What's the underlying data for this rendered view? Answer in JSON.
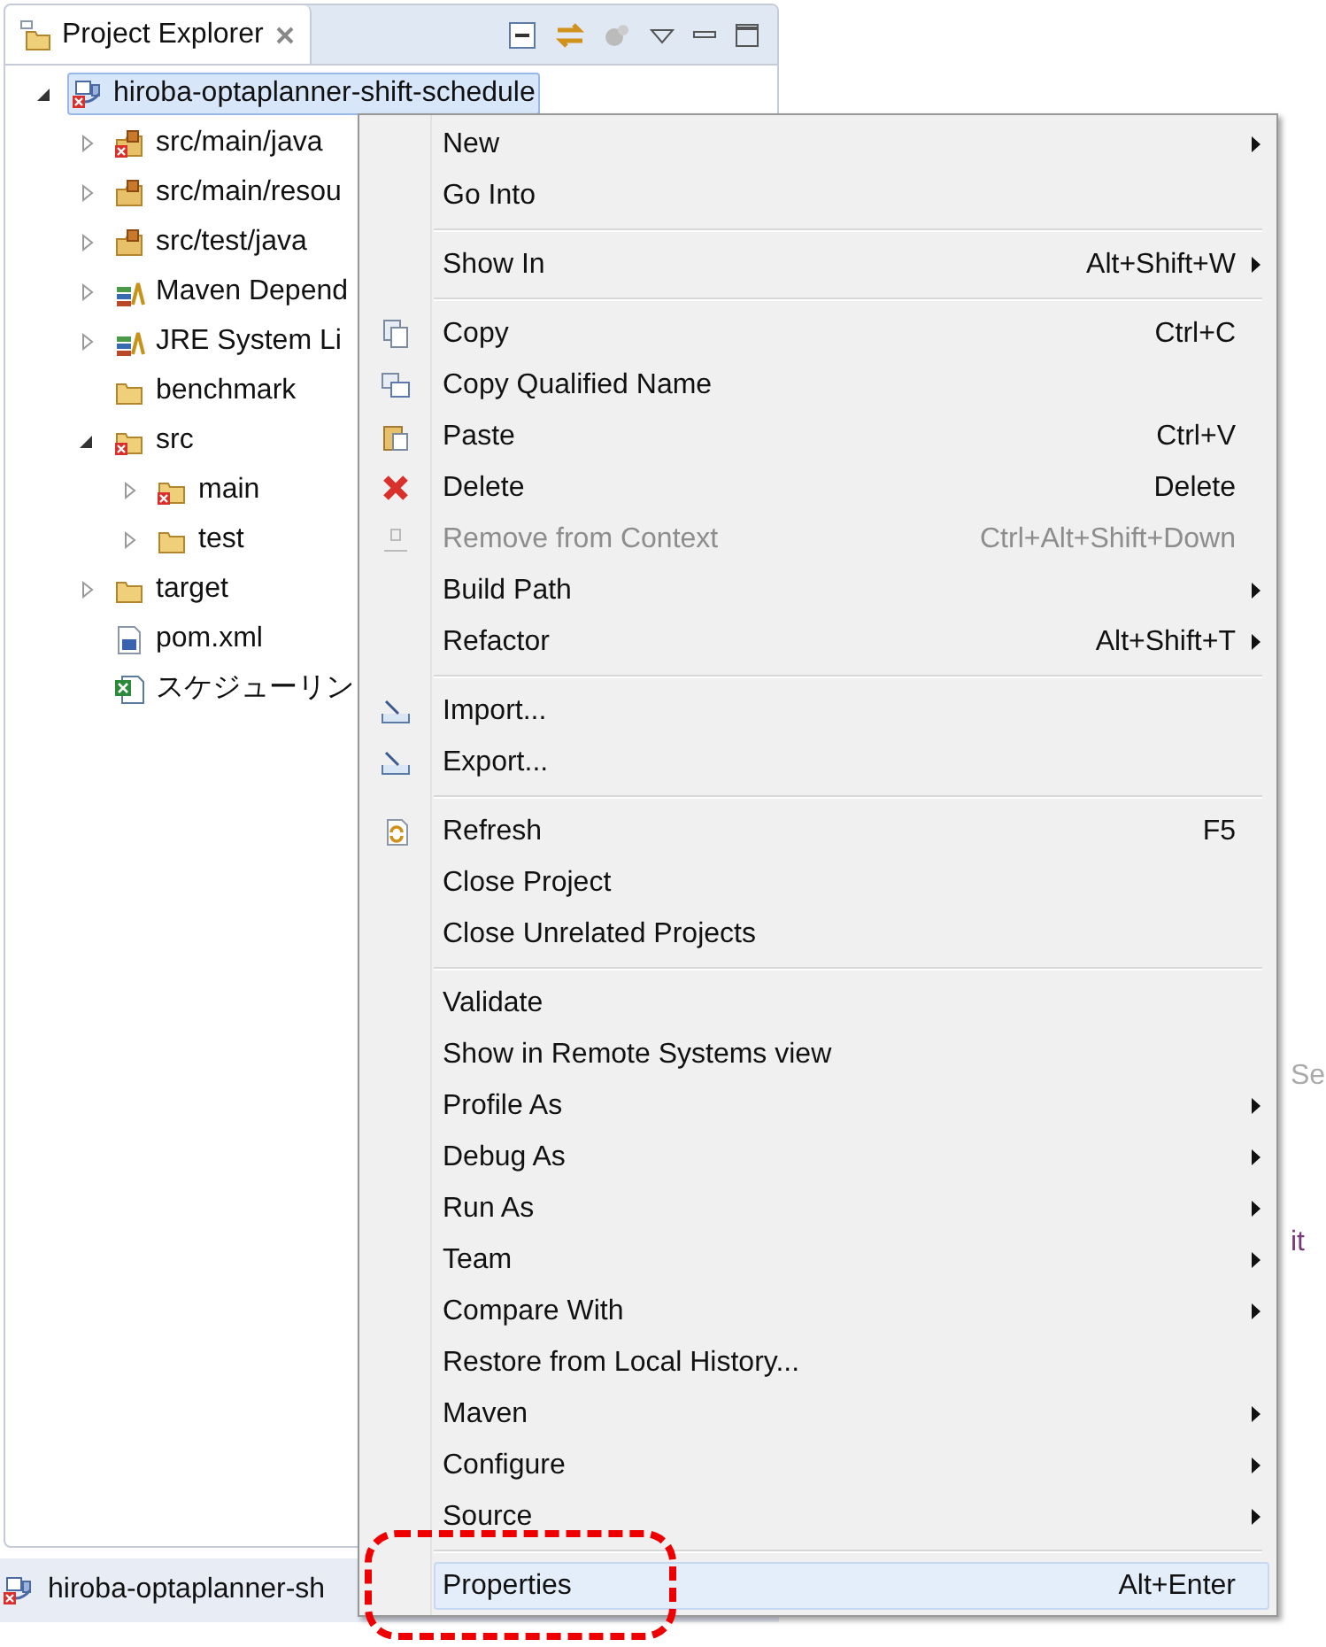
{
  "panel": {
    "title": "Project Explorer",
    "tree": [
      {
        "label": "hiroba-optaplanner-shift-schedule",
        "kind": "project",
        "error": true,
        "selected": true,
        "expanded": true,
        "children": [
          {
            "label": "src/main/java",
            "kind": "package-folder",
            "error": true,
            "selected": false,
            "expanded": false
          },
          {
            "label": "src/main/resou",
            "kind": "package-folder",
            "error": false,
            "selected": false,
            "expanded": false
          },
          {
            "label": "src/test/java",
            "kind": "package-folder",
            "error": false,
            "selected": false,
            "expanded": false
          },
          {
            "label": "Maven Depend",
            "kind": "library",
            "error": false,
            "selected": false,
            "expanded": false
          },
          {
            "label": "JRE System Li",
            "kind": "library",
            "error": false,
            "selected": false,
            "expanded": false
          },
          {
            "label": "benchmark",
            "kind": "folder",
            "error": false,
            "selected": false
          },
          {
            "label": "src",
            "kind": "folder",
            "error": true,
            "selected": false,
            "expanded": true,
            "children": [
              {
                "label": "main",
                "kind": "folder",
                "error": true,
                "selected": false,
                "expanded": false
              },
              {
                "label": "test",
                "kind": "folder",
                "error": false,
                "selected": false,
                "expanded": false
              }
            ]
          },
          {
            "label": "target",
            "kind": "folder",
            "error": false,
            "selected": false,
            "expanded": false
          },
          {
            "label": "pom.xml",
            "kind": "maven-file",
            "error": false,
            "selected": false
          },
          {
            "label": "スケジューリン",
            "kind": "excel-file",
            "error": false,
            "selected": false
          }
        ]
      }
    ]
  },
  "context_menu": {
    "groups": [
      [
        {
          "label": "New",
          "submenu": true,
          "disabled": false,
          "selected": false
        },
        {
          "label": "Go Into",
          "submenu": false,
          "disabled": false,
          "selected": false
        }
      ],
      [
        {
          "label": "Show In",
          "shortcut": "Alt+Shift+W",
          "submenu": true,
          "disabled": false,
          "selected": false
        }
      ],
      [
        {
          "label": "Copy",
          "shortcut": "Ctrl+C",
          "submenu": false,
          "disabled": false,
          "selected": false
        },
        {
          "label": "Copy Qualified Name",
          "submenu": false,
          "disabled": false,
          "selected": false
        },
        {
          "label": "Paste",
          "shortcut": "Ctrl+V",
          "submenu": false,
          "disabled": false,
          "selected": false
        },
        {
          "label": "Delete",
          "shortcut": "Delete",
          "submenu": false,
          "disabled": false,
          "selected": false
        },
        {
          "label": "Remove from Context",
          "shortcut": "Ctrl+Alt+Shift+Down",
          "submenu": false,
          "disabled": true,
          "selected": false
        },
        {
          "label": "Build Path",
          "submenu": true,
          "disabled": false,
          "selected": false
        },
        {
          "label": "Refactor",
          "shortcut": "Alt+Shift+T",
          "submenu": true,
          "disabled": false,
          "selected": false
        }
      ],
      [
        {
          "label": "Import...",
          "submenu": false,
          "disabled": false,
          "selected": false
        },
        {
          "label": "Export...",
          "submenu": false,
          "disabled": false,
          "selected": false
        }
      ],
      [
        {
          "label": "Refresh",
          "shortcut": "F5",
          "submenu": false,
          "disabled": false,
          "selected": false
        },
        {
          "label": "Close Project",
          "submenu": false,
          "disabled": false,
          "selected": false
        },
        {
          "label": "Close Unrelated Projects",
          "submenu": false,
          "disabled": false,
          "selected": false
        }
      ],
      [
        {
          "label": "Validate",
          "submenu": false,
          "disabled": false,
          "selected": false
        },
        {
          "label": "Show in Remote Systems view",
          "submenu": false,
          "disabled": false,
          "selected": false
        },
        {
          "label": "Profile As",
          "submenu": true,
          "disabled": false,
          "selected": false
        },
        {
          "label": "Debug As",
          "submenu": true,
          "disabled": false,
          "selected": false
        },
        {
          "label": "Run As",
          "submenu": true,
          "disabled": false,
          "selected": false
        },
        {
          "label": "Team",
          "submenu": true,
          "disabled": false,
          "selected": false
        },
        {
          "label": "Compare With",
          "submenu": true,
          "disabled": false,
          "selected": false
        },
        {
          "label": "Restore from Local History...",
          "submenu": false,
          "disabled": false,
          "selected": false
        },
        {
          "label": "Maven",
          "submenu": true,
          "disabled": false,
          "selected": false
        },
        {
          "label": "Configure",
          "submenu": true,
          "disabled": false,
          "selected": false
        },
        {
          "label": "Source",
          "submenu": true,
          "disabled": false,
          "selected": false
        }
      ],
      [
        {
          "label": "Properties",
          "shortcut": "Alt+Enter",
          "submenu": false,
          "disabled": false,
          "selected": true,
          "annotated": true
        }
      ]
    ]
  },
  "background_fragments": [
    "Se",
    "it"
  ],
  "status_bar": {
    "label": "hiroba-optaplanner-sh",
    "error": true
  }
}
